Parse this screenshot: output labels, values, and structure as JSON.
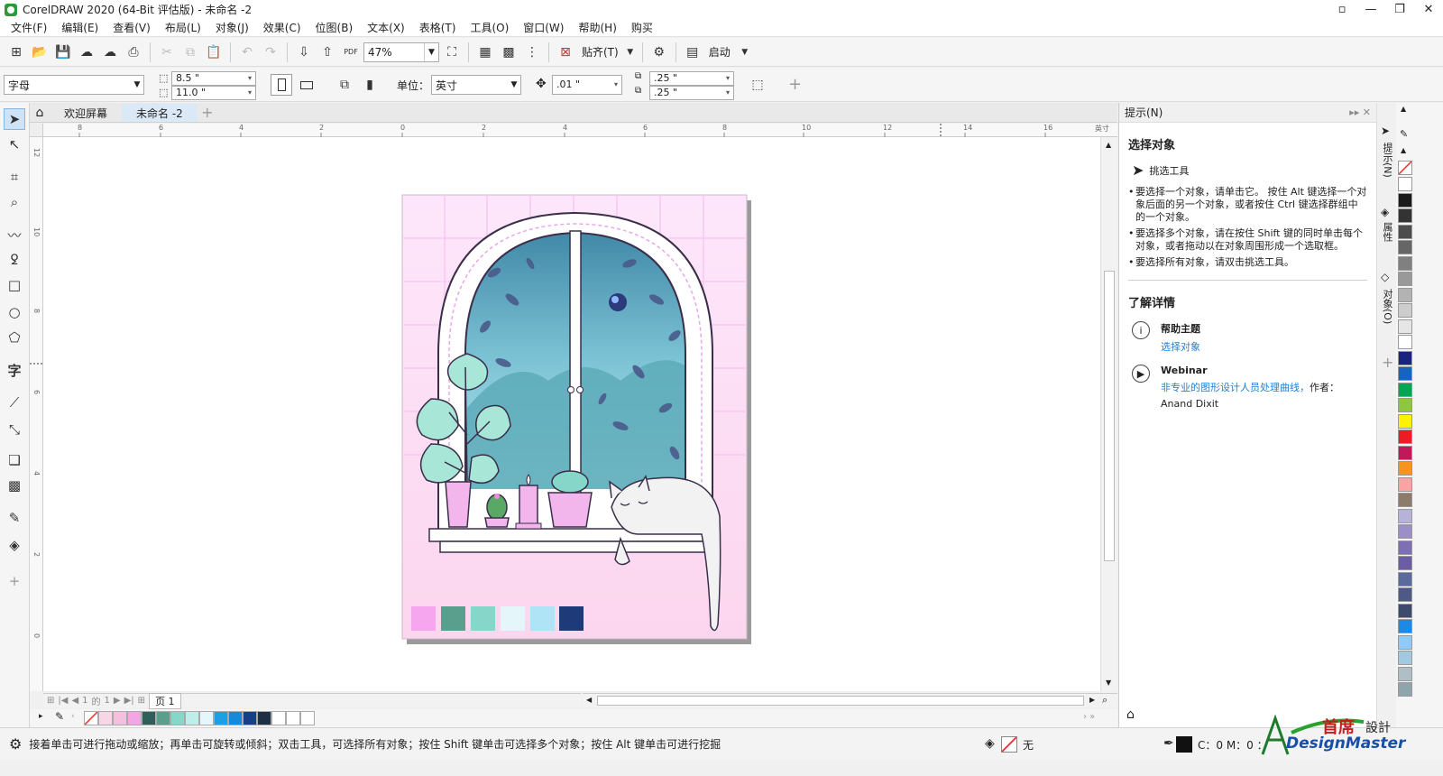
{
  "window": {
    "title": "CorelDRAW 2020 (64-Bit 评估版) - 未命名 -2"
  },
  "menu": [
    "文件(F)",
    "编辑(E)",
    "查看(V)",
    "布局(L)",
    "对象(J)",
    "效果(C)",
    "位图(B)",
    "文本(X)",
    "表格(T)",
    "工具(O)",
    "窗口(W)",
    "帮助(H)",
    "购买"
  ],
  "toolbar": {
    "zoom": "47%",
    "snap_label": "贴齐(T)",
    "launch_label": "启动",
    "pdf_label": "PDF"
  },
  "propbar": {
    "paper_type": "字母",
    "width": "8.5 \"",
    "height": "11.0 \"",
    "unit_label": "单位：",
    "unit_value": "英寸",
    "nudge": ".01 \"",
    "dup_x": ".25 \"",
    "dup_y": ".25 \""
  },
  "tabs": [
    {
      "label": "欢迎屏幕"
    },
    {
      "label": "未命名 -2"
    }
  ],
  "rulers": {
    "h_ticks": [
      "8",
      "6",
      "4",
      "2",
      "0",
      "2",
      "4",
      "6",
      "8",
      "10",
      "12",
      "14",
      "16"
    ],
    "h_unit": "英寸",
    "v_ticks": [
      "12",
      "10",
      "8",
      "6",
      "4",
      "2",
      "0"
    ]
  },
  "pagenav": {
    "current": "1",
    "of": "的",
    "total": "1",
    "page_label": "页 1"
  },
  "status": {
    "hint": "接着单击可进行拖动或缩放；再单击可旋转或倾斜；双击工具，可选择所有对象；按住 Shift 键单击可选择多个对象；按住 Alt 键单击可进行挖掘",
    "fill_none": "无",
    "color_readout": "C：0 M：0 ："
  },
  "docker": {
    "title": "提示(N)",
    "heading": "选择对象",
    "tool_name": "挑选工具",
    "tips": [
      "要选择一个对象，请单击它。 按住 Alt 键选择一个对象后面的另一个对象，或者按住 Ctrl 键选择群组中的一个对象。",
      "要选择多个对象，请在按住 Shift 键的同时单击每个对象，或者拖动以在对象周围形成一个选取框。",
      "要选择所有对象，请双击挑选工具。"
    ],
    "learn_more": "了解详情",
    "help_title": "帮助主题",
    "help_link": "选择对象",
    "webinar_title": "Webinar",
    "webinar_link": "非专业的图形设计人员处理曲线，",
    "webinar_author_label": "作者：",
    "webinar_author": "Anand Dixit"
  },
  "dock_tabs": [
    "提示(N)",
    "属性",
    "对象(O)"
  ],
  "logo": {
    "cn": "首席",
    "cn2": "設計",
    "en": "DesignMaster"
  },
  "palette_bottom": [
    "#f7d6e6",
    "#f5c0de",
    "#f4a6e4",
    "#2f5f5a",
    "#5a9e8e",
    "#86d7c9",
    "#bfeeea",
    "#e7f6fb",
    "#1ca0e3",
    "#1689d8",
    "#173f86",
    "#1f2f46",
    "#ffffff",
    "#ffffff",
    "#ffffff"
  ],
  "palette_right": [
    "#ffffff",
    "#1a1a1a",
    "#333333",
    "#4d4d4d",
    "#666666",
    "#808080",
    "#999999",
    "#b3b3b3",
    "#cccccc",
    "#e6e6e6",
    "#ffffff",
    "#1a237e",
    "#1565c0",
    "#00a651",
    "#8dc63f",
    "#fff200",
    "#ed1c24",
    "#c2185b",
    "#f7941d",
    "#f9a3a3",
    "#8c7b6b",
    "#b5b3d6",
    "#9c8fc7",
    "#7d6fb3",
    "#6a5da3",
    "#5b6a9e",
    "#4e5a85",
    "#3c4a6e",
    "#1e88e5",
    "#90caf9",
    "#a3c9e0",
    "#b0bec5",
    "#90a4ae"
  ],
  "artwork_swatches": [
    "#f5a6ee",
    "#5a9e8e",
    "#86d7c9",
    "#e5f6fb",
    "#aee4f5",
    "#1f3a78"
  ]
}
